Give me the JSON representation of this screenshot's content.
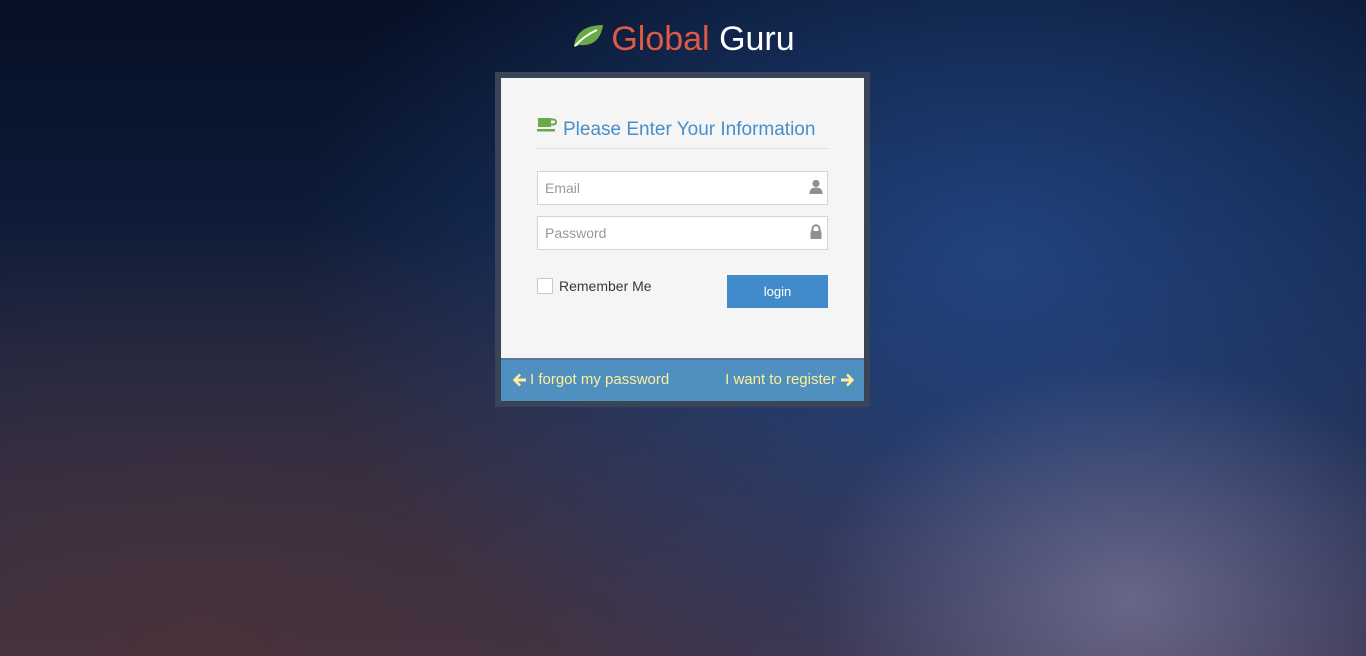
{
  "brand": {
    "word1": "Global",
    "word2": "Guru",
    "icon": "leaf-icon",
    "colors": {
      "word1": "#dd5a43",
      "word2": "#ffffff",
      "icon": "#69aa46"
    }
  },
  "login": {
    "header": "Please Enter Your Information",
    "header_icon": "coffee-icon",
    "email": {
      "value": "",
      "placeholder": "Email",
      "icon": "user-icon"
    },
    "password": {
      "value": "",
      "placeholder": "Password",
      "icon": "lock-icon"
    },
    "remember_label": "Remember Me",
    "remember_checked": false,
    "login_button": "login"
  },
  "toolbar": {
    "forgot_label": "I forgot my password",
    "register_label": "I want to register",
    "link_color": "#ffee99"
  },
  "colors": {
    "accent": "#428bca",
    "toolbar_bg": "#5090c1",
    "frame": "#394557",
    "panel": "#f5f5f5"
  }
}
